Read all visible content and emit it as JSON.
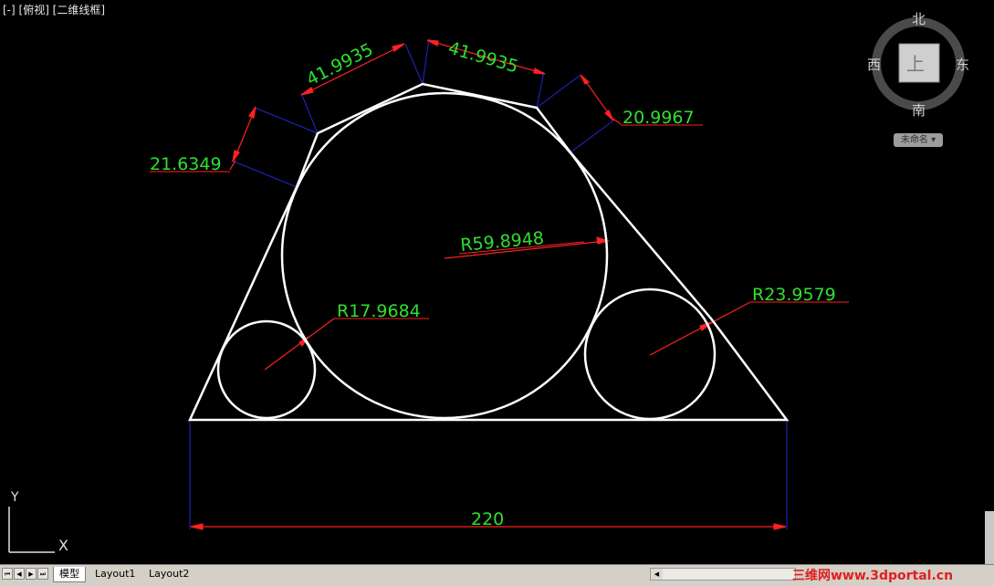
{
  "viewport": {
    "label": "[-] [俯视] [二维线框]"
  },
  "dimensions": {
    "top_left": "41.9935",
    "top_right": "41.9935",
    "right_slant": "20.9967",
    "left_slant": "21.6349",
    "big_radius": "R59.8948",
    "small_left_radius": "R17.9684",
    "small_right_radius": "R23.9579",
    "base_width": "220"
  },
  "viewcube": {
    "north": "北",
    "south": "南",
    "east": "东",
    "west": "西",
    "face": "上",
    "named_view": "未命名"
  },
  "ucs": {
    "x_label": "X",
    "y_label": "Y"
  },
  "tabs": [
    {
      "label": "模型",
      "active": true
    },
    {
      "label": "Layout1",
      "active": false
    },
    {
      "label": "Layout2",
      "active": false
    }
  ],
  "watermark": "三维网www.3dportal.cn",
  "colors": {
    "geometry": "#ffffff",
    "dimension_text": "#2ee02e",
    "dimension_arrow": "#ff2020",
    "extension_line": "#2020d0"
  }
}
